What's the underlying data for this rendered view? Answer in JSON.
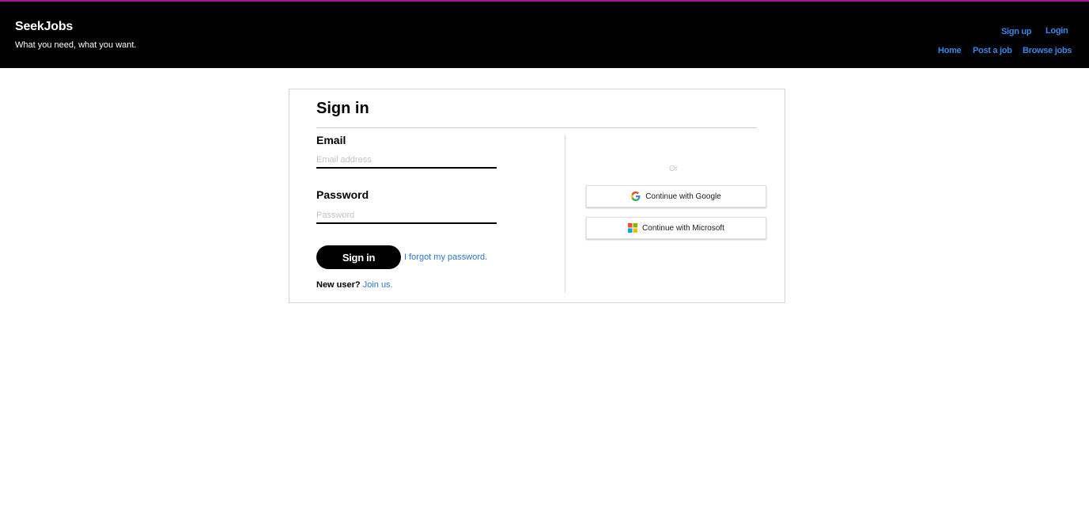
{
  "header": {
    "brand": "SeekJobs",
    "tagline": "What you need, what you want.",
    "nav_top": [
      "Sign up",
      "Login"
    ],
    "nav_bottom": [
      "Home",
      "Post a job",
      "Browse jobs"
    ]
  },
  "signin": {
    "title": "Sign in",
    "email_label": "Email",
    "email_placeholder": "Email address",
    "email_value": "",
    "password_label": "Password",
    "password_placeholder": "Password",
    "password_value": "",
    "submit_label": "Sign in",
    "forgot_link": "I forgot my password.",
    "new_user_label": "New user?",
    "join_link": "Join us."
  },
  "sso": {
    "or_text": "Or",
    "google_label": "Continue with Google",
    "microsoft_label": "Continue with Microsoft",
    "google_icon": "google-g-icon",
    "microsoft_icon": "microsoft-squares-icon"
  },
  "colors": {
    "accent_border": "#a3179a",
    "link": "#3a86e8",
    "header_bg": "#000000"
  }
}
